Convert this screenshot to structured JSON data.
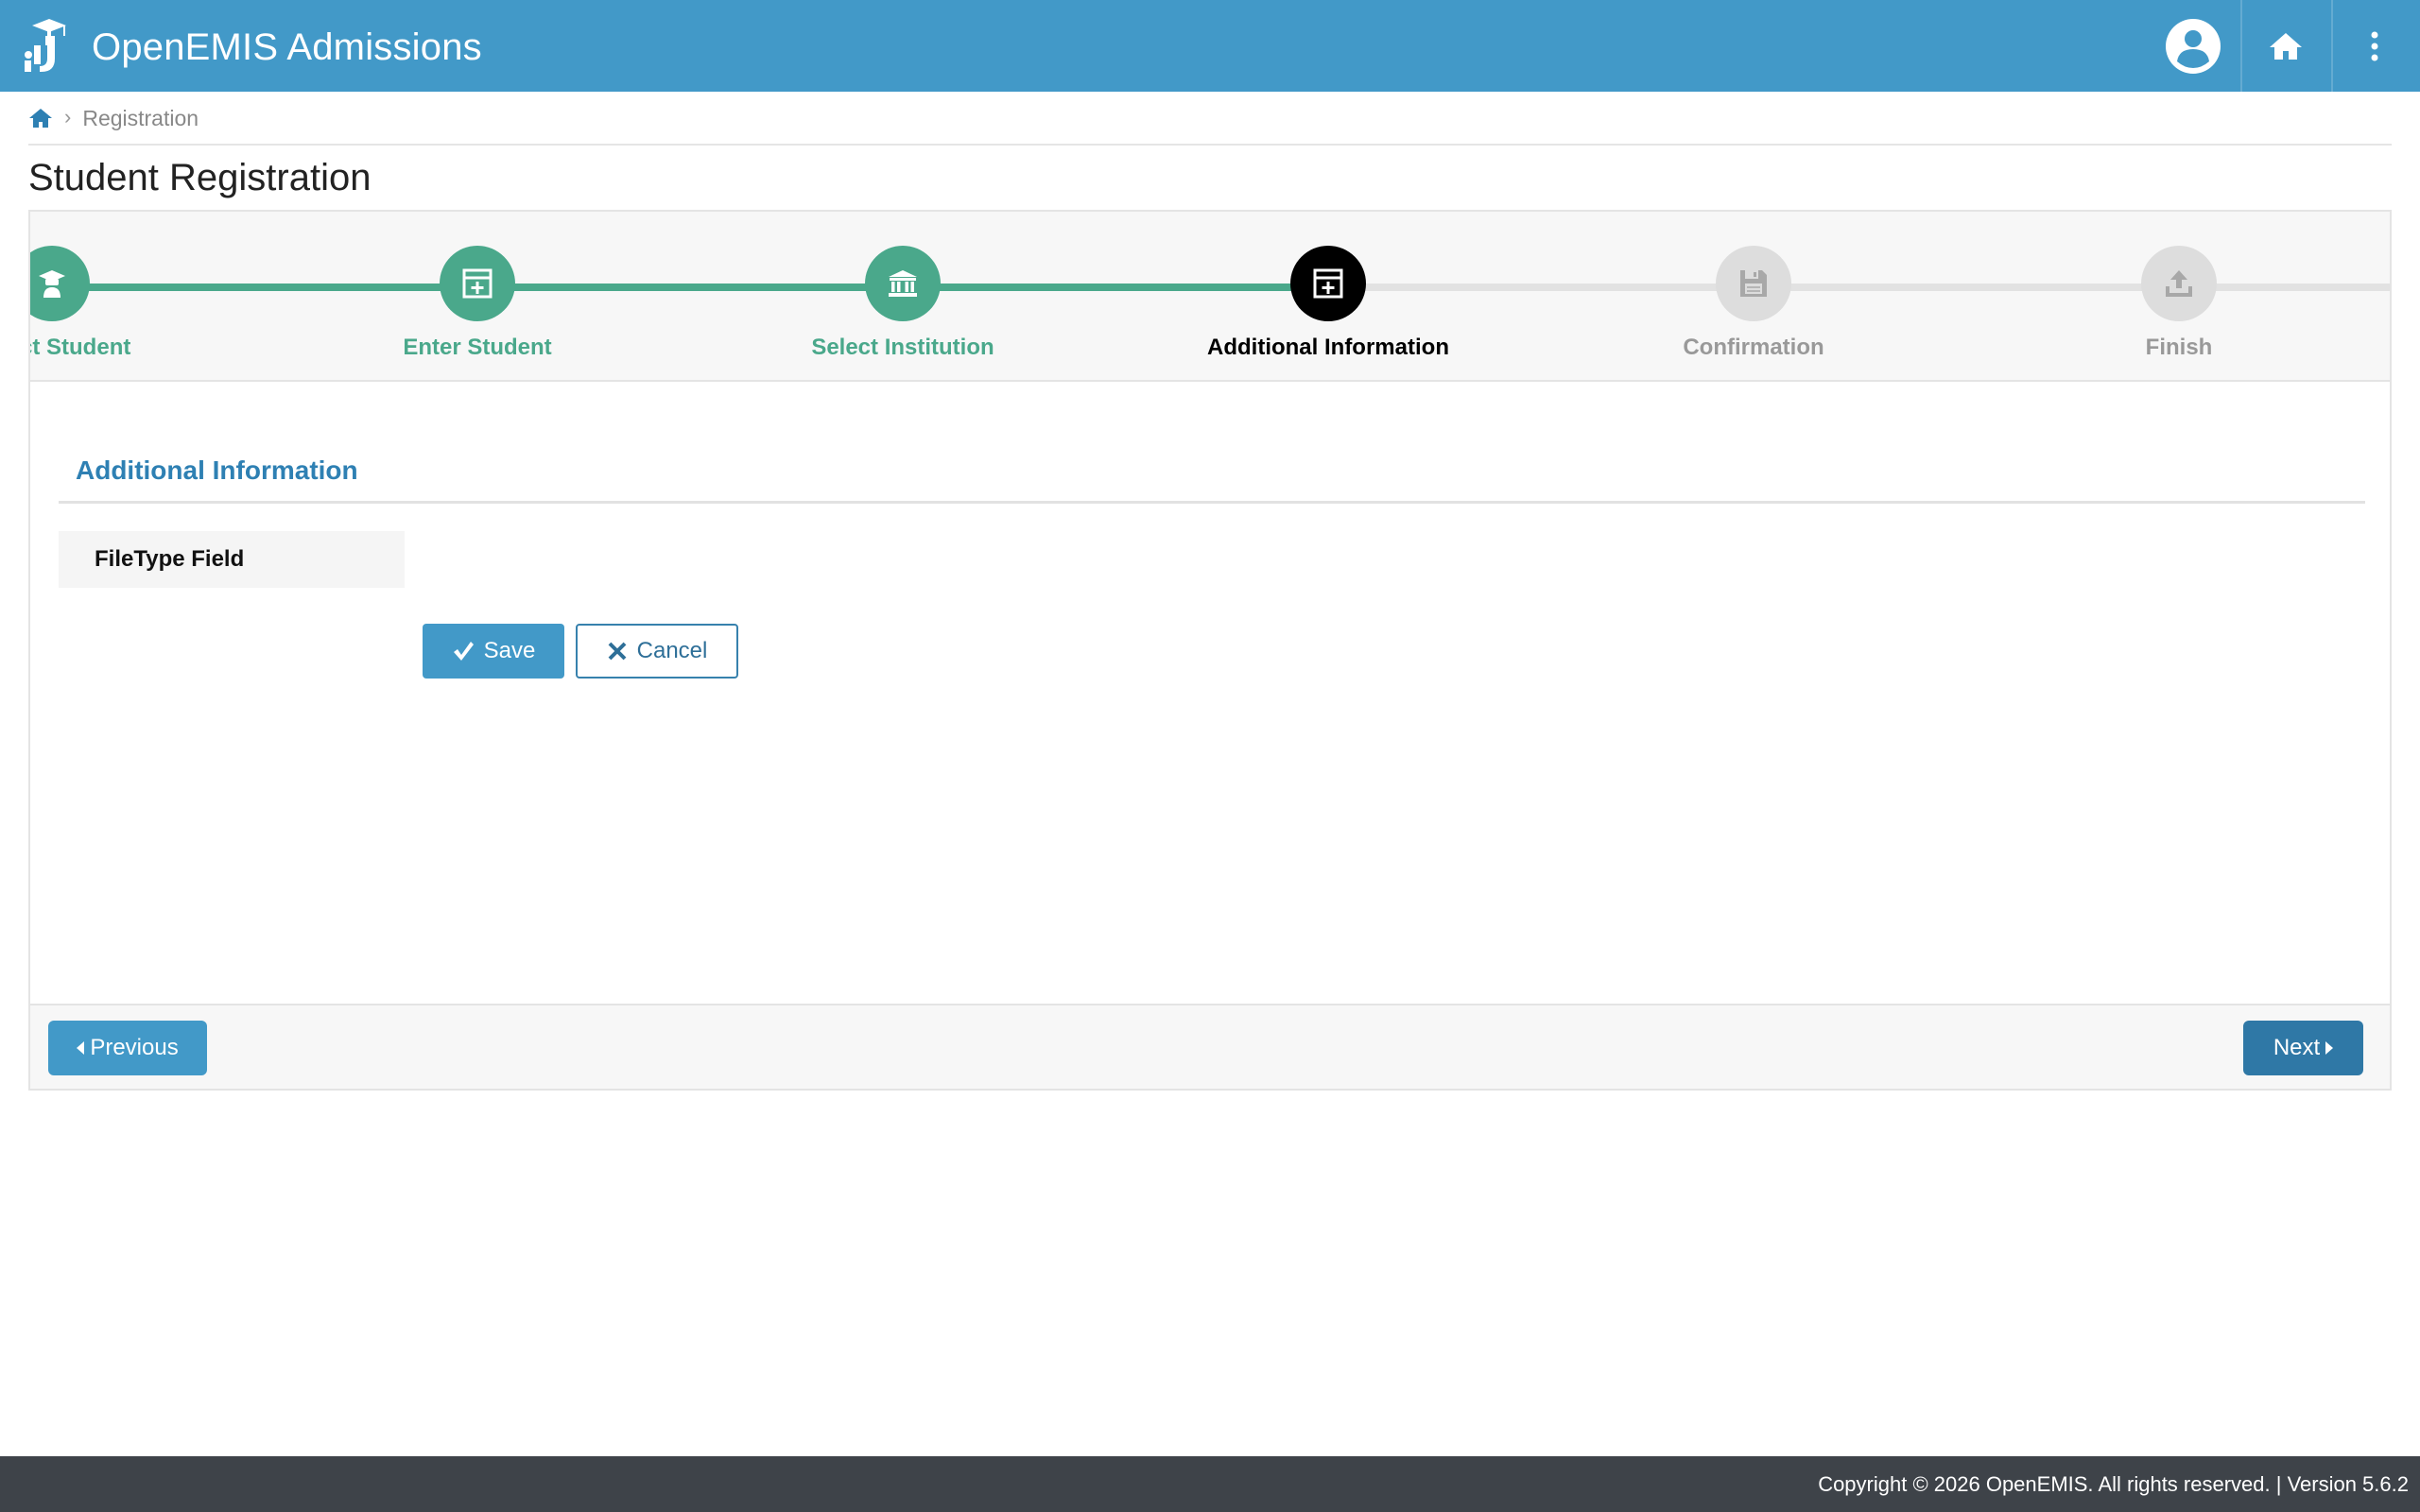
{
  "header": {
    "app_title": "OpenEMIS Admissions",
    "logo_icon": "openemis-logo-icon",
    "user_icon": "user-avatar-icon",
    "home_icon": "home-icon",
    "more_icon": "more-vertical-icon"
  },
  "breadcrumb": {
    "items": [
      "Registration"
    ]
  },
  "page": {
    "title": "Student Registration"
  },
  "wizard": {
    "steps": [
      {
        "label": "Select Student",
        "state": "done",
        "icon": "graduate-icon"
      },
      {
        "label": "Enter Student",
        "state": "done",
        "icon": "plus-square-icon"
      },
      {
        "label": "Select Institution",
        "state": "done",
        "icon": "institution-icon"
      },
      {
        "label": "Additional Information",
        "state": "active",
        "icon": "plus-square-icon"
      },
      {
        "label": "Confirmation",
        "state": "todo",
        "icon": "floppy-icon"
      },
      {
        "label": "Finish",
        "state": "todo",
        "icon": "upload-icon"
      }
    ],
    "section_title": "Additional Information",
    "field_label": "FileType Field",
    "save_label": "Save",
    "cancel_label": "Cancel",
    "previous_label": "Previous",
    "next_label": "Next"
  },
  "footer": {
    "copyright": "Copyright © 2026 OpenEMIS. All rights reserved. | Version 5.6.2"
  },
  "colors": {
    "topbar": "#4299c8",
    "step_done": "#4aa88b",
    "step_active": "#000000",
    "step_todo": "#dddddd",
    "section_title": "#2e80b3",
    "footer": "#3e4349"
  }
}
